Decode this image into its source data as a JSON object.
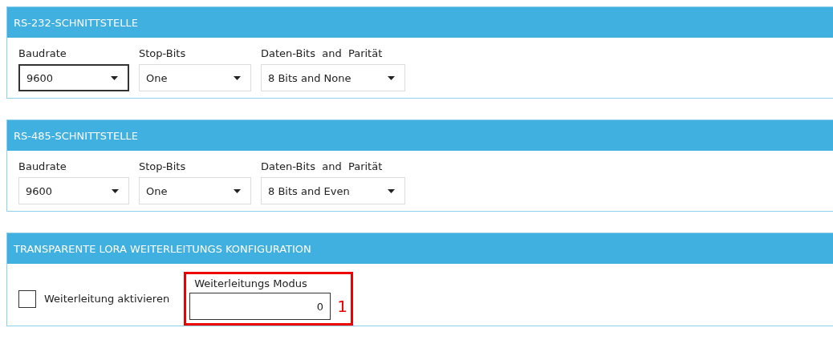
{
  "sections": [
    {
      "kind": "dropdowns",
      "title": "RS-232-SCHNITTSTELLE",
      "fields": [
        {
          "label": "Baudrate",
          "value": "9600",
          "focused": true
        },
        {
          "label": "Stop-Bits",
          "value": "One",
          "focused": false
        },
        {
          "label": "Daten-Bits  and  Parität",
          "value": "8 Bits and None",
          "focused": false
        }
      ]
    },
    {
      "kind": "dropdowns",
      "title": "RS-485-SCHNITTSTELLE",
      "fields": [
        {
          "label": "Baudrate",
          "value": "9600",
          "focused": false
        },
        {
          "label": "Stop-Bits",
          "value": "One",
          "focused": false
        },
        {
          "label": "Daten-Bits  and  Parität",
          "value": "8 Bits and Even",
          "focused": false
        }
      ]
    },
    {
      "kind": "forwarding",
      "title": "TRANSPARENTE LORA WEITERLEITUNGS KONFIGURATION",
      "checkbox": {
        "label": "Weiterleitung aktivieren",
        "checked": false
      },
      "mode": {
        "label": "Weiterleitungs Modus",
        "value": "0",
        "highlighted": true,
        "callout": "1"
      }
    }
  ]
}
